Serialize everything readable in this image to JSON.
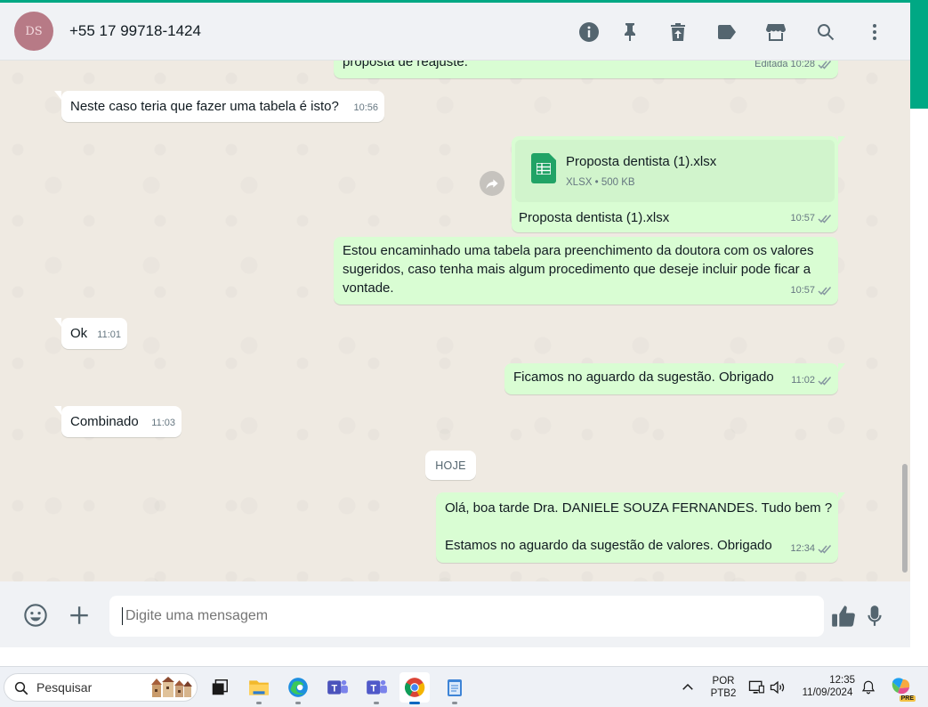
{
  "header": {
    "avatar_text": "DS",
    "contact_name": "+55 17 99718-1424",
    "icons": [
      "info-icon",
      "pin-icon",
      "delete-icon",
      "label-icon",
      "catalog-icon",
      "search-icon",
      "menu-icon"
    ]
  },
  "messages": [
    {
      "id": "m0",
      "direction": "out",
      "text": "proposta de reajuste.",
      "edited_label": "Editada",
      "time": "10:28",
      "ticks": true
    },
    {
      "id": "m1",
      "direction": "in",
      "text": "Neste caso teria que fazer uma tabela é isto?",
      "time": "10:56"
    },
    {
      "id": "m2",
      "direction": "out",
      "doc_name": "Proposta dentista (1).xlsx",
      "doc_type": "XLSX",
      "doc_size": "500 KB",
      "caption": "Proposta dentista (1).xlsx",
      "time": "10:57",
      "ticks": true
    },
    {
      "id": "m3",
      "direction": "out",
      "text": "Estou encaminhado uma tabela para preenchimento da doutora com os valores sugeridos, caso tenha mais algum procedimento que deseje incluir pode ficar a vontade.",
      "time": "10:57",
      "ticks": true
    },
    {
      "id": "m4",
      "direction": "in",
      "text": "Ok",
      "time": "11:01"
    },
    {
      "id": "m5",
      "direction": "out",
      "text": "Ficamos no aguardo da sugestão. Obrigado",
      "time": "11:02",
      "ticks": true
    },
    {
      "id": "m6",
      "direction": "in",
      "text": "Combinado",
      "time": "11:03"
    },
    {
      "id": "m7",
      "direction": "out",
      "text_line1": "Olá, boa tarde Dra. DANIELE SOUZA FERNANDES. Tudo bem ?",
      "text_line2": "Estamos no aguardo da sugestão de valores. Obrigado",
      "time": "12:34",
      "ticks": true
    }
  ],
  "date_divider": "HOJE",
  "composer": {
    "placeholder": "Digite uma mensagem",
    "icons": [
      "emoji-icon",
      "plus-icon",
      "thumbs-up-icon",
      "mic-icon"
    ]
  },
  "taskbar": {
    "search_label": "Pesquisar",
    "apps": [
      "task-view-icon",
      "file-explorer-icon",
      "edge-icon",
      "teams-icon",
      "teams-new-icon",
      "chrome-icon",
      "notepad-icon"
    ],
    "lang_line1": "POR",
    "lang_line2": "PTB2",
    "time": "12:35",
    "date": "11/09/2024",
    "badge_text": "PRE"
  },
  "colors": {
    "accent": "#00a884",
    "outgoing_bubble": "#d9fdd3",
    "incoming_bubble": "#ffffff",
    "chat_bg": "#efeae2"
  }
}
